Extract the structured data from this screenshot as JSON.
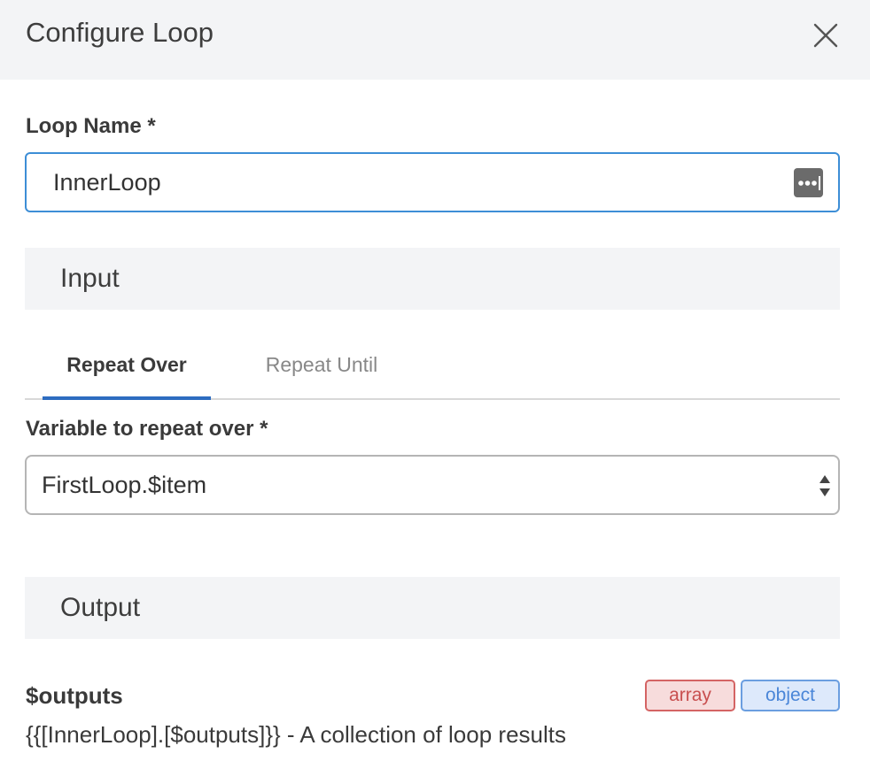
{
  "header": {
    "title": "Configure Loop",
    "close_icon": "close-icon"
  },
  "loop_name": {
    "label": "Loop Name *",
    "value": "InnerLoop",
    "options_icon": "more-dots-icon"
  },
  "input_section": {
    "title": "Input",
    "tabs": [
      {
        "label": "Repeat Over",
        "active": true
      },
      {
        "label": "Repeat Until",
        "active": false
      }
    ],
    "variable_label": "Variable to repeat over *",
    "variable_value": "FirstLoop.$item"
  },
  "output_section": {
    "title": "Output",
    "outputs": [
      {
        "name": "$outputs",
        "description": "{{[InnerLoop].[$outputs]}} - A collection of loop results",
        "types": [
          "array",
          "object"
        ]
      }
    ]
  },
  "colors": {
    "accent": "#2d6cc0",
    "input_focus_border": "#3d8ed6",
    "array_badge": "#d46464",
    "object_badge": "#6b9ee0"
  }
}
